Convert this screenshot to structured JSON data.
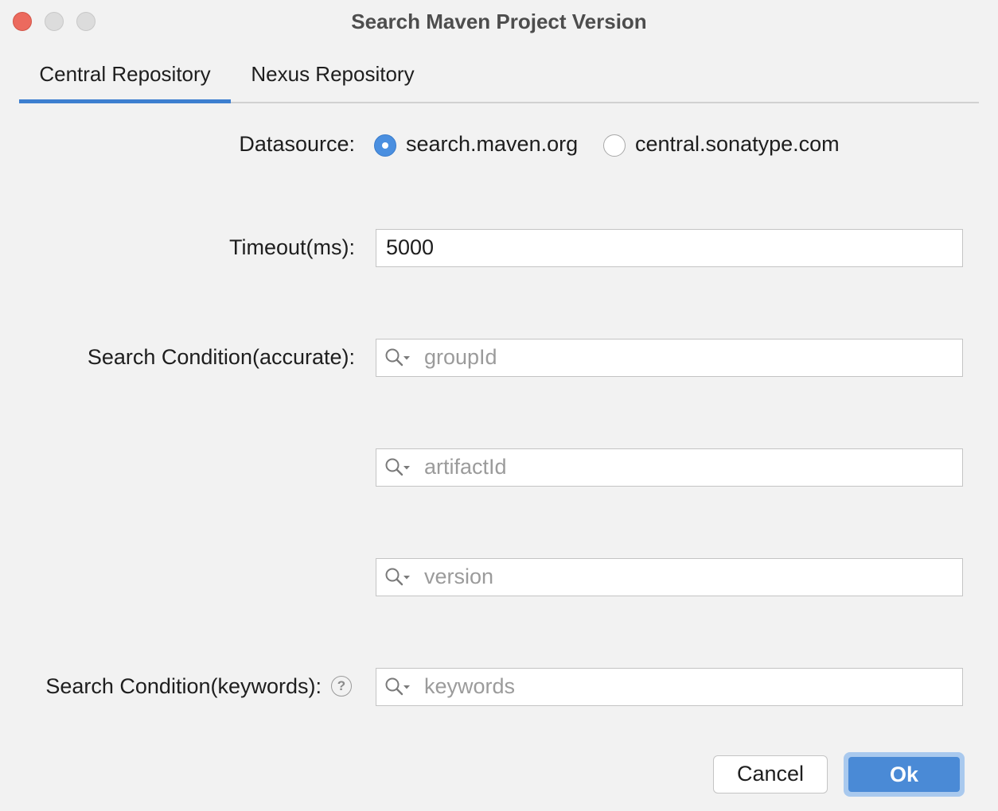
{
  "window": {
    "title": "Search Maven Project Version"
  },
  "tabs": [
    {
      "label": "Central Repository",
      "active": true
    },
    {
      "label": "Nexus Repository",
      "active": false
    }
  ],
  "form": {
    "datasource_label": "Datasource:",
    "datasource_options": [
      {
        "label": "search.maven.org",
        "selected": true
      },
      {
        "label": "central.sonatype.com",
        "selected": false
      }
    ],
    "timeout_label": "Timeout(ms):",
    "timeout_value": "5000",
    "accurate_label": "Search Condition(accurate):",
    "groupid_placeholder": "groupId",
    "artifactid_placeholder": "artifactId",
    "version_placeholder": "version",
    "keywords_label": "Search Condition(keywords):",
    "keywords_placeholder": "keywords",
    "help_glyph": "?"
  },
  "buttons": {
    "cancel": "Cancel",
    "ok": "Ok"
  },
  "colors": {
    "accent": "#3d7fd0",
    "close": "#ec6a5e",
    "ok_button": "#4a8ad6"
  },
  "icons": {
    "search": "search-icon",
    "help": "help-icon"
  }
}
